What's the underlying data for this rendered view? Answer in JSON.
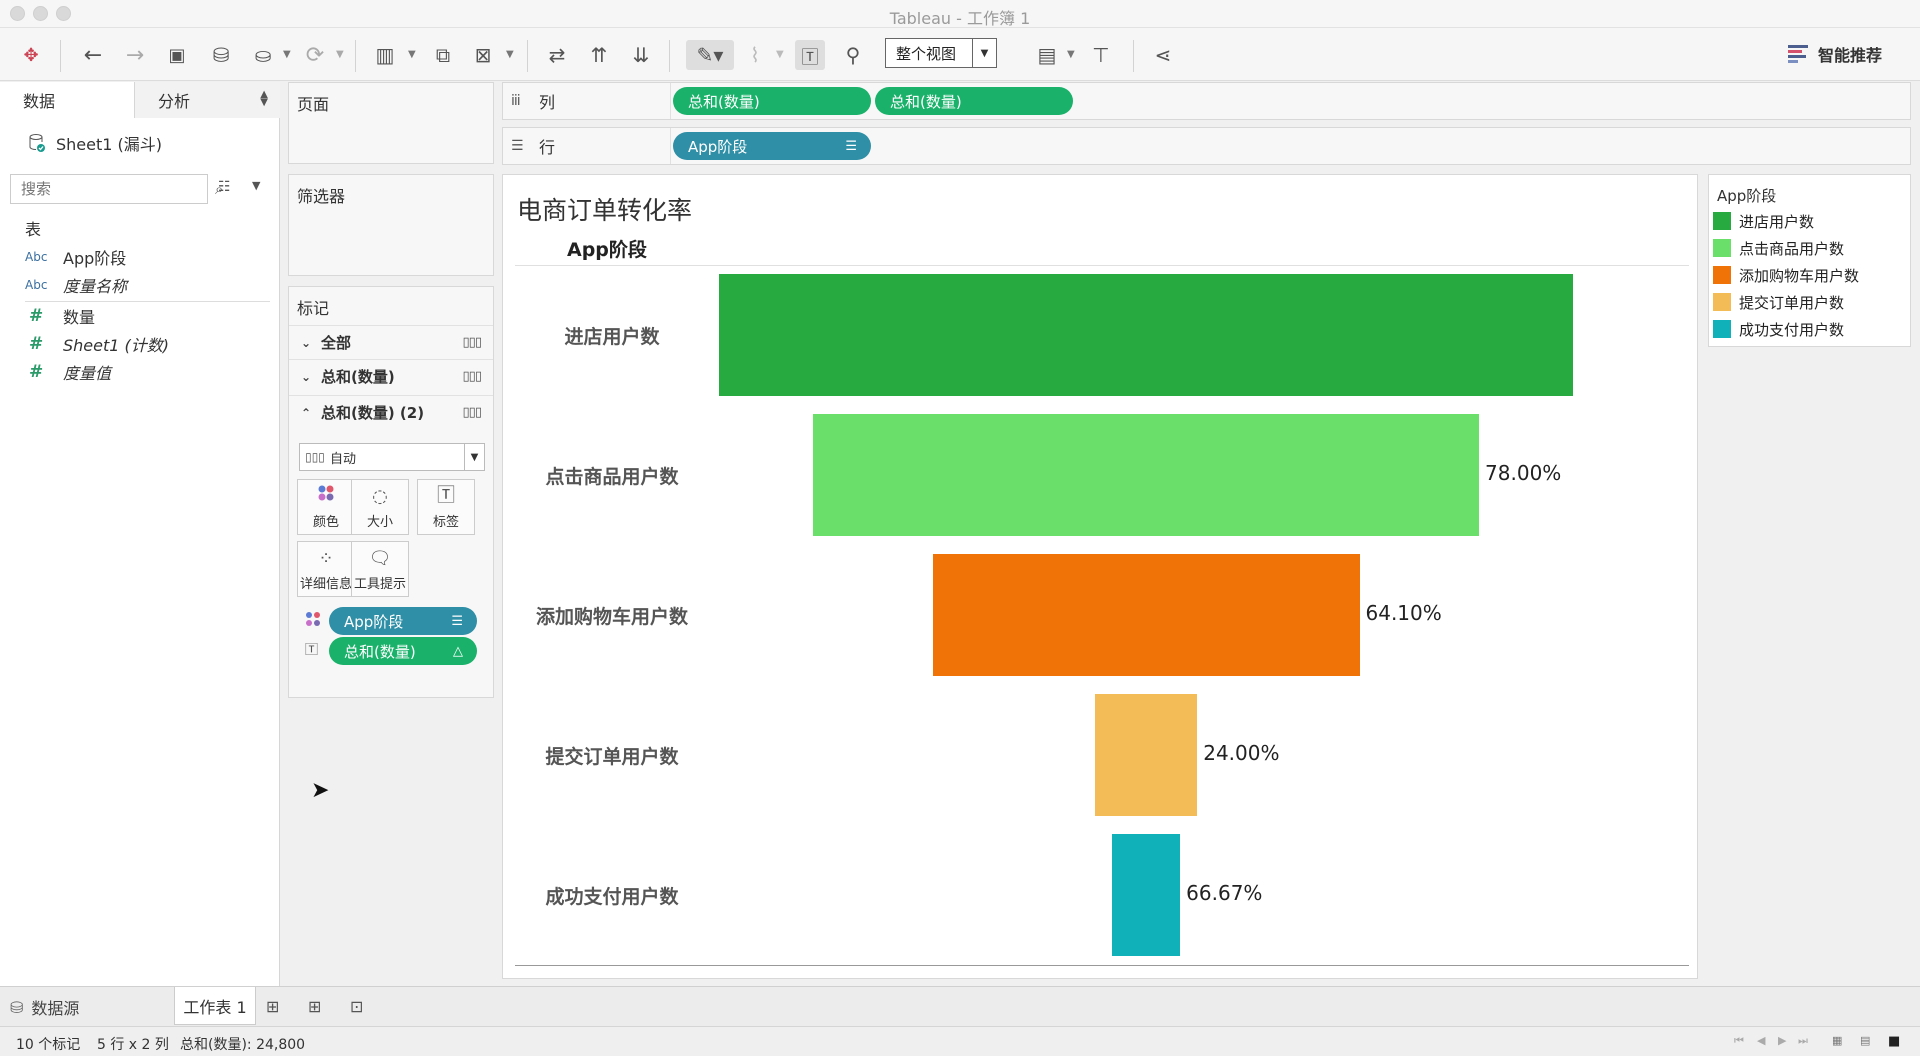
{
  "window": {
    "title": "Tableau - 工作簿 1"
  },
  "toolbar": {
    "view_mode": "整个视图",
    "smart_recommend": "智能推荐"
  },
  "data_pane": {
    "tabs": [
      "数据",
      "分析"
    ],
    "source": "Sheet1 (漏斗)",
    "search_placeholder": "搜索",
    "section_title": "表",
    "fields": [
      {
        "type": "Abc",
        "name": "App阶段",
        "italic": false
      },
      {
        "type": "Abc",
        "name": "度量名称",
        "italic": true
      },
      {
        "type": "#",
        "name": "数量",
        "italic": false
      },
      {
        "type": "#",
        "name": "Sheet1 (计数)",
        "italic": true
      },
      {
        "type": "#",
        "name": "度量值",
        "italic": true
      }
    ]
  },
  "pages_card": {
    "title": "页面"
  },
  "filters_card": {
    "title": "筛选器"
  },
  "marks_card": {
    "title": "标记",
    "rows": [
      "全部",
      "总和(数量)",
      "总和(数量) (2)"
    ],
    "mark_type": "自动",
    "buttons": [
      "颜色",
      "大小",
      "标签",
      "详细信息",
      "工具提示"
    ],
    "pills": [
      "App阶段",
      "总和(数量)"
    ]
  },
  "columns_shelf": {
    "label": "列",
    "pills": [
      "总和(数量)",
      "总和(数量)"
    ]
  },
  "rows_shelf": {
    "label": "行",
    "pills": [
      "App阶段"
    ]
  },
  "legend": {
    "title": "App阶段",
    "items": [
      {
        "label": "进店用户数",
        "color": "#27ab41"
      },
      {
        "label": "点击商品用户数",
        "color": "#6ae06a"
      },
      {
        "label": "添加购物车用户数",
        "color": "#ef7307"
      },
      {
        "label": "提交订单用户数",
        "color": "#f3bc56"
      },
      {
        "label": "成功支付用户数",
        "color": "#10b1b8"
      }
    ]
  },
  "chart_data": {
    "type": "bar",
    "title": "电商订单转化率",
    "row_header": "App阶段",
    "categories": [
      "进店用户数",
      "点击商品用户数",
      "添加购物车用户数",
      "提交订单用户数",
      "成功支付用户数"
    ],
    "values": [
      10000,
      7800,
      5000,
      1200,
      800
    ],
    "labels": [
      "",
      "78.00%",
      "64.10%",
      "24.00%",
      "66.67%"
    ],
    "colors": [
      "#27ab41",
      "#6ae06a",
      "#ef7307",
      "#f3bc56",
      "#10b1b8"
    ],
    "style": "centered-funnel"
  },
  "bottom": {
    "datasource_tab": "数据源",
    "sheet_tab": "工作表 1",
    "status": [
      "10 个标记",
      "5 行 x 2 列",
      "总和(数量): 24,800"
    ]
  }
}
